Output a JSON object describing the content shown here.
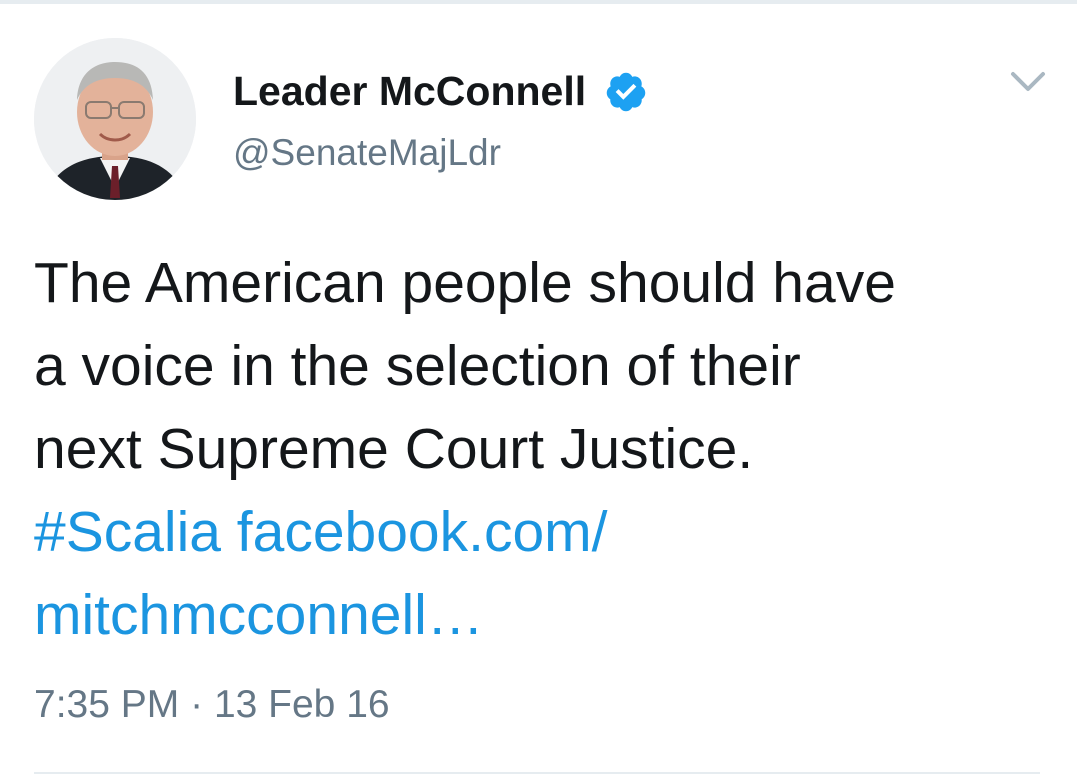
{
  "tweet": {
    "author": {
      "name": "Leader McConnell",
      "handle": "@SenateMajLdr",
      "verified": true
    },
    "text_lines": [
      "The American people should have",
      "a voice in the selection of their",
      "next Supreme Court Justice."
    ],
    "hashtag": "#Scalia",
    "link_part1": "facebook.com/",
    "link_part2": "mitchmcconnell…",
    "time": "7:35 PM",
    "separator": "·",
    "date": "13 Feb 16"
  },
  "colors": {
    "link": "#1b95e0",
    "text": "#14171a",
    "secondary": "#657786",
    "verified_badge": "#1da1f2",
    "divider": "#e6ecf0"
  },
  "icons": {
    "verified": "verified-badge-icon",
    "more": "chevron-down-icon"
  }
}
